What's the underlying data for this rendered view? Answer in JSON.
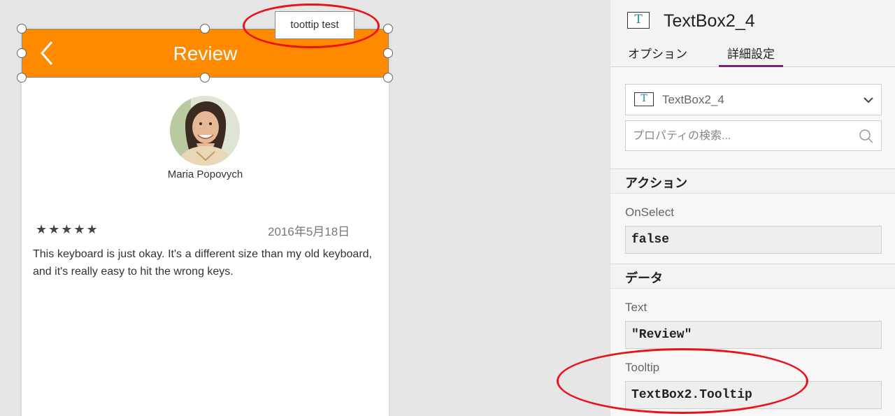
{
  "canvas": {
    "header": {
      "title": "Review",
      "color": "#ff8a00"
    },
    "tooltip": {
      "text": "toottip test"
    },
    "review": {
      "name": "Maria Popovych",
      "stars": "★★★★★",
      "date": "2016年5月18日",
      "text": "This keyboard is just okay. It's a different size than my old keyboard, and it's really easy to hit the wrong keys."
    }
  },
  "panel": {
    "control_name": "TextBox2_4",
    "control_icon": "T",
    "tabs": [
      {
        "label": "オプション",
        "active": false
      },
      {
        "label": "詳細設定",
        "active": true
      }
    ],
    "dropdown": {
      "value": "TextBox2_4"
    },
    "search": {
      "placeholder": "プロパティの検索..."
    },
    "sections": {
      "action": {
        "title": "アクション",
        "onselect": {
          "label": "OnSelect",
          "value": "false"
        }
      },
      "data": {
        "title": "データ",
        "text": {
          "label": "Text",
          "value": "\"Review\""
        },
        "tooltip": {
          "label": "Tooltip",
          "value": "TextBox2.Tooltip"
        }
      }
    }
  },
  "colors": {
    "accent": "#742774",
    "annotation": "#e8141c",
    "header": "#ff8a00"
  }
}
